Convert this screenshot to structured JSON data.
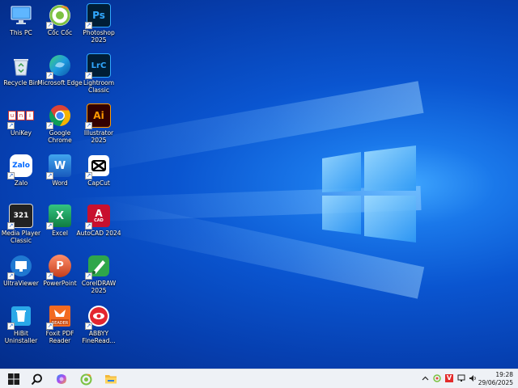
{
  "desktop": {
    "icons": [
      {
        "label": "This PC"
      },
      {
        "label": "Cốc Cốc"
      },
      {
        "label": "Photoshop 2025"
      },
      {
        "label": "Recycle Bin"
      },
      {
        "label": "Microsoft Edge"
      },
      {
        "label": "Lightroom Classic"
      },
      {
        "label": "UniKey"
      },
      {
        "label": "Google Chrome"
      },
      {
        "label": "Illustrator 2025"
      },
      {
        "label": "Zalo"
      },
      {
        "label": "Word"
      },
      {
        "label": "CapCut"
      },
      {
        "label": "Media Player Classic"
      },
      {
        "label": "Excel"
      },
      {
        "label": "AutoCAD 2024"
      },
      {
        "label": "UltraViewer"
      },
      {
        "label": "PowerPoint"
      },
      {
        "label": "CorelDRAW 2025"
      },
      {
        "label": "HiBit Uninstaller"
      },
      {
        "label": "Foxit PDF Reader"
      },
      {
        "label": "ABBYY FineRead..."
      }
    ],
    "glyphs": {
      "ps": "Ps",
      "lrc": "LrC",
      "ai": "Ai",
      "zalo": "Zalo",
      "word": "W",
      "excel": "X",
      "autocad": "A",
      "autocad_sub": "CAD",
      "ppt": "P",
      "mpc": "321",
      "unikey": "u"
    }
  },
  "taskbar": {
    "clock_time": "19:28",
    "clock_date": "29/06/2025",
    "tray_v": "V"
  },
  "colors": {
    "accent": "#0a55d0",
    "taskbar_bg": "#eef1f6"
  }
}
